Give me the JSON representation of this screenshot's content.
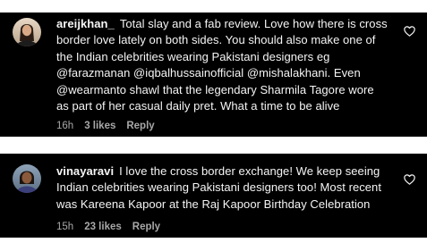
{
  "comments": [
    {
      "username": "areijkhan_",
      "lines": [
        "Total slay and a fab review. Love how there is cross",
        "border love lately on both sides. You should also make one of",
        "the Indian celebrities wearing Pakistani designers eg",
        "@farazmanan @iqbalhussainofficial @mishalakhani. Even",
        "@wearmanto shawl that the legendary Sharmila Tagore wore",
        "as part of her casual daily pret. What a time to be alive"
      ],
      "time": "16h",
      "likes": "3 likes",
      "reply": "Reply"
    },
    {
      "username": "vinayaravi",
      "lines": [
        "I love the cross border exchange! We keep seeing",
        "Indian celebrities wearing Pakistani designers too! Most recent",
        "was Kareena Kapoor at the Raj Kapoor Birthday Celebration"
      ],
      "time": "15h",
      "likes": "23 likes",
      "reply": "Reply"
    }
  ],
  "icons": {
    "like": "heart-outline-icon"
  },
  "colors": {
    "card_background": "#000000",
    "page_background": "#ffffff",
    "text": "#f5f5f5",
    "meta_text": "#a8a8a8"
  }
}
